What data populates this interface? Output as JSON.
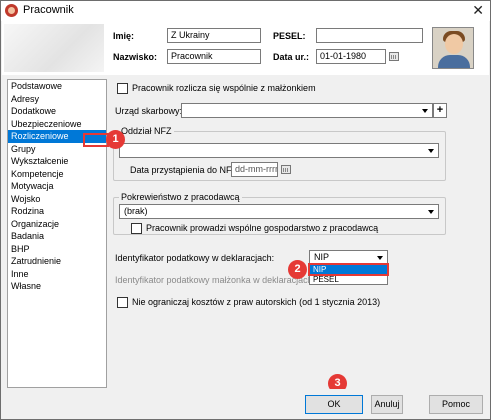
{
  "window": {
    "title": "Pracownik",
    "close_glyph": "✕"
  },
  "header": {
    "imie_label": "Imię:",
    "imie_value": "Z Ukrainy",
    "nazwisko_label": "Nazwisko:",
    "nazwisko_value": "Pracownik",
    "pesel_label": "PESEL:",
    "pesel_value": "",
    "data_ur_label": "Data ur.:",
    "data_ur_value": "01-01-1980"
  },
  "sidebar": {
    "items": [
      "Podstawowe",
      "Adresy",
      "Dodatkowe",
      "Ubezpieczeniowe",
      "Rozliczeniowe",
      "Grupy",
      "Wykształcenie",
      "Kompetencje",
      "Motywacja",
      "Wojsko",
      "Rodzina",
      "Organizacje",
      "Badania",
      "BHP",
      "Zatrudnienie",
      "Inne",
      "Własne"
    ],
    "selected": "Rozliczeniowe"
  },
  "form": {
    "rozlicza_label": "Pracownik rozlicza się wspólnie z małżonkiem",
    "urzad_label": "Urząd skarbowy:",
    "urzad_value": "",
    "nfz_group": "Oddział NFZ",
    "nfz_value": "",
    "nfz_date_label": "Data przystąpienia do NFZ:",
    "nfz_date_value": "dd-mm-rrrr",
    "pokrewienstwo_group": "Pokrewieństwo z pracodawcą",
    "pokrewienstwo_value": "(brak)",
    "gospodarstwo_label": "Pracownik prowadzi wspólne gospodarstwo z pracodawcą",
    "identyfikator_label": "Identyfikator podatkowy w deklaracjach:",
    "identyfikator_value": "NIP",
    "identyfikator_options": [
      "NIP",
      "PESEL"
    ],
    "identyfikator_selected": "NIP",
    "identyfikator_malzonka_label": "Identyfikator podatkowy małżonka w deklaracjach:",
    "koszty_label": "Nie ograniczaj kosztów z praw autorskich (od 1 stycznia 2013)"
  },
  "annotations": {
    "badge1": "1",
    "badge2": "2",
    "badge3": "3"
  },
  "footer": {
    "ok_label": "OK",
    "cancel_label": "Anuluj",
    "help_label": "Pomoc"
  },
  "colors": {
    "selection": "#0078d7",
    "annotation": "#e53935",
    "window_bg": "#f0f0f0"
  }
}
